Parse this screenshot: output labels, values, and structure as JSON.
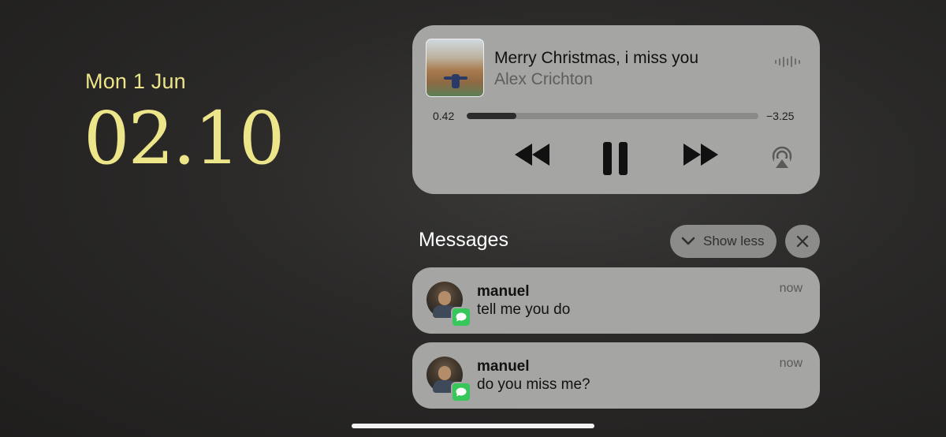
{
  "lock_screen": {
    "date": "Mon 1 Jun",
    "time": "02.10",
    "accent_color": "#ede58a"
  },
  "now_playing": {
    "title": "Merry Christmas, i miss you",
    "artist": "Alex Crichton",
    "elapsed": "0.42",
    "remaining": "−3.25",
    "progress_fraction": 0.17,
    "icons": {
      "waveform": "waveform-icon",
      "previous": "rewind-icon",
      "pause": "pause-icon",
      "next": "fast-forward-icon",
      "airplay": "airplay-icon"
    }
  },
  "messages_group": {
    "title": "Messages",
    "show_less_label": "Show less",
    "notifications": [
      {
        "sender": "manuel",
        "text": "tell me you do",
        "time": "now"
      },
      {
        "sender": "manuel",
        "text": "do you miss me?",
        "time": "now"
      }
    ],
    "app_color": "#35c759"
  }
}
